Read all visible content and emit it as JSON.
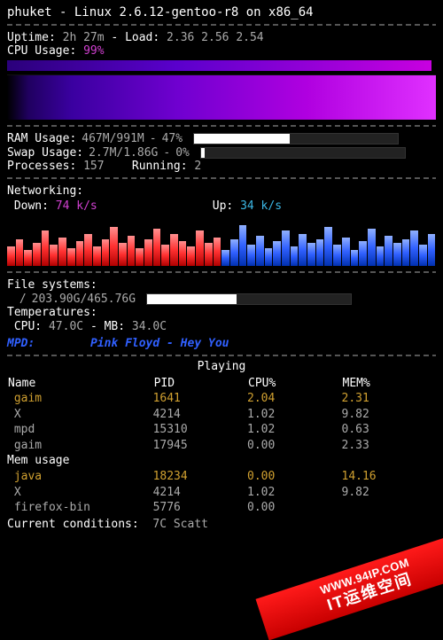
{
  "hostname": "phuket",
  "os_line": "Linux 2.6.12-gentoo-r8 on x86_64",
  "uptime_label": "Uptime:",
  "uptime_value": "2h 27m",
  "load_label": "Load:",
  "load_value": "2.36 2.56 2.54",
  "cpu_label": "CPU Usage:",
  "cpu_value": "99%",
  "ram_label": "RAM Usage:",
  "ram_used": "467M/991M",
  "ram_pct": "47%",
  "ram_pct_num": 47,
  "swap_label": "Swap Usage:",
  "swap_used": "2.7M/1.86G",
  "swap_pct": "0%",
  "swap_pct_num": 2,
  "proc_label": "Processes:",
  "proc_count": "157",
  "running_label": "Running:",
  "running_count": "2",
  "net_label": "Networking:",
  "down_label": "Down:",
  "down_value": "74 k/s",
  "up_label": "Up:",
  "up_value": "34 k/s",
  "fs_label": "File systems:",
  "fs_mount": "/",
  "fs_value": "203.90G/465.76G",
  "fs_pct_num": 44,
  "temp_label": "Temperatures:",
  "temp_cpu_label": "CPU:",
  "temp_cpu_value": "47.0C",
  "temp_mb_label": "MB:",
  "temp_mb_value": "34.0C",
  "mpd_label": "MPD:",
  "mpd_track": "Pink Floyd - Hey You",
  "playing_label": "Playing",
  "col_name": "Name",
  "col_pid": "PID",
  "col_cpu": "CPU%",
  "col_mem": "MEM%",
  "cpu_procs": [
    {
      "name": "gaim",
      "pid": "1641",
      "cpu": "2.04",
      "mem": "2.31",
      "hl": true
    },
    {
      "name": "X",
      "pid": "4214",
      "cpu": "1.02",
      "mem": "9.82",
      "hl": false
    },
    {
      "name": "mpd",
      "pid": "15310",
      "cpu": "1.02",
      "mem": "0.63",
      "hl": false
    },
    {
      "name": "gaim",
      "pid": "17945",
      "cpu": "0.00",
      "mem": "2.33",
      "hl": false
    }
  ],
  "mem_label": "Mem usage",
  "mem_procs": [
    {
      "name": "java",
      "pid": "18234",
      "cpu": "0.00",
      "mem": "14.16",
      "hl": true
    },
    {
      "name": "X",
      "pid": "4214",
      "cpu": "1.02",
      "mem": "9.82",
      "hl": false
    },
    {
      "name": "firefox-bin",
      "pid": "5776",
      "cpu": "0.00",
      "mem": "",
      "hl": false
    }
  ],
  "weather_label": "Current conditions:",
  "weather_value": "7C Scatt",
  "banner_small": "WWW.94IP.COM",
  "banner_big": "IT运维空间",
  "net_bars": [
    22,
    30,
    18,
    26,
    40,
    24,
    32,
    20,
    28,
    36,
    22,
    30,
    44,
    26,
    34,
    20,
    30,
    42,
    24,
    36,
    28,
    22,
    40,
    26,
    32,
    18,
    30,
    46,
    24,
    34,
    20,
    28,
    40,
    22,
    36,
    26,
    30,
    44,
    24,
    32,
    18,
    28,
    42,
    22,
    34,
    26,
    30,
    40,
    24,
    36
  ]
}
